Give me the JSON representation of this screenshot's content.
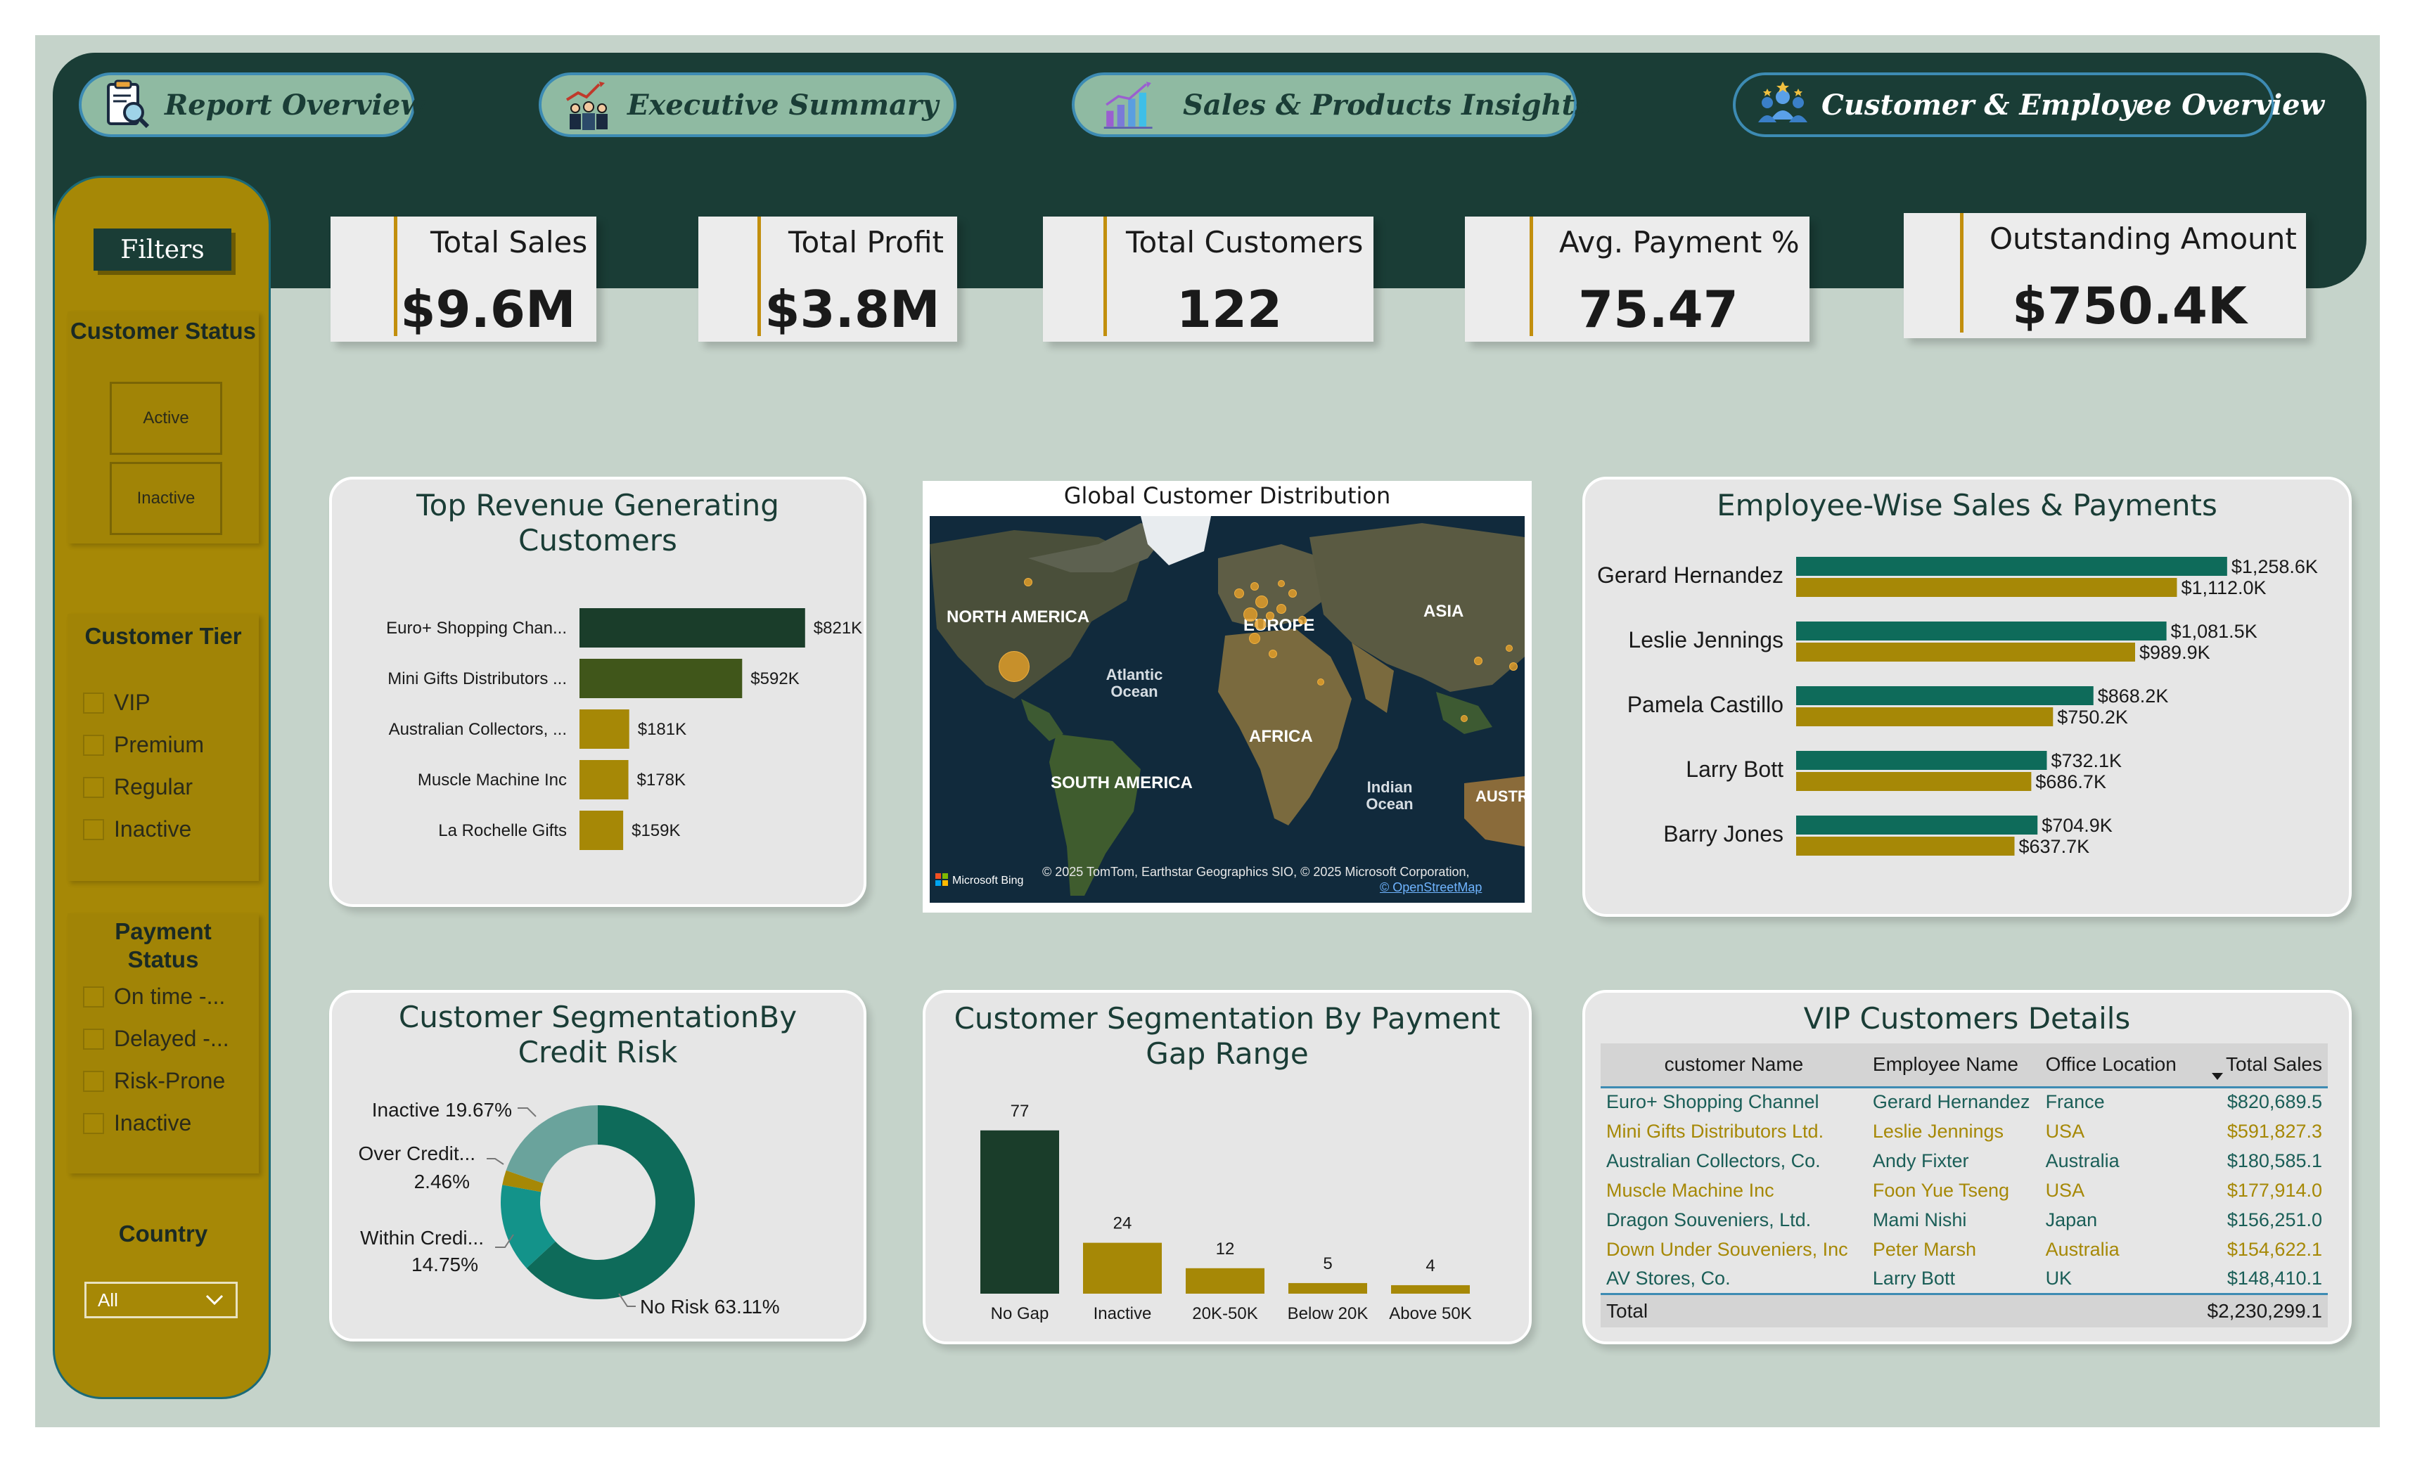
{
  "nav": {
    "tabs": [
      {
        "label": "Report Overview",
        "icon": "report-magnifier-icon"
      },
      {
        "label": "Executive Summary",
        "icon": "executive-team-icon"
      },
      {
        "label": "Sales & Products Insights",
        "icon": "bar-chart-growth-icon"
      },
      {
        "label": "Customer & Employee Overview",
        "icon": "team-group-icon"
      }
    ],
    "active": "Customer & Employee Overview"
  },
  "filters": {
    "title": "Filters",
    "customer_status": {
      "heading": "Customer Status",
      "options": [
        "Active",
        "Inactive"
      ]
    },
    "customer_tier": {
      "heading": "Customer Tier",
      "options": [
        "VIP",
        "Premium",
        "Regular",
        "Inactive"
      ]
    },
    "payment_status": {
      "heading": "Payment Status",
      "options": [
        "On time -...",
        "Delayed -...",
        "Risk-Prone",
        "Inactive"
      ]
    },
    "country": {
      "heading": "Country",
      "selected": "All"
    }
  },
  "kpis": [
    {
      "title": "Total Sales",
      "value": "$9.6M"
    },
    {
      "title": "Total Profit",
      "value": "$3.8M"
    },
    {
      "title": "Total Customers",
      "value": "122"
    },
    {
      "title": "Avg. Payment %",
      "value": "75.47"
    },
    {
      "title": "Outstanding Amount",
      "value": "$750.4K"
    }
  ],
  "top_customers": {
    "title": "Top Revenue Generating Customers",
    "chart_data": {
      "type": "bar",
      "orientation": "horizontal",
      "categories": [
        "Euro+ Shopping Chan...",
        "Mini Gifts Distributors ...",
        "Australian Collectors, ...",
        "Muscle Machine Inc",
        "La Rochelle Gifts"
      ],
      "values": [
        821,
        592,
        181,
        178,
        159
      ],
      "value_labels": [
        "$821K",
        "$592K",
        "$181K",
        "$178K",
        "$159K"
      ],
      "colors": [
        "#1a3d2a",
        "#40561a",
        "#a68806",
        "#a68806",
        "#a68806"
      ],
      "xlim": [
        0,
        900
      ]
    }
  },
  "map": {
    "title": "Global Customer Distribution",
    "labels": [
      "NORTH AMERICA",
      "EUROPE",
      "ASIA",
      "Atlantic Ocean",
      "AFRICA",
      "SOUTH AMERICA",
      "Indian Ocean",
      "AUSTR"
    ],
    "attribution": "© 2025 TomTom, Earthstar Geographics SIO, © 2025 Microsoft Corporation,",
    "osm_link": "© OpenStreetMap",
    "brand": "Microsoft Bing"
  },
  "employee_sales": {
    "title": "Employee-Wise Sales & Payments",
    "chart_data": {
      "type": "bar",
      "orientation": "horizontal",
      "categories": [
        "Gerard Hernandez",
        "Leslie Jennings",
        "Pamela Castillo",
        "Larry Bott",
        "Barry Jones"
      ],
      "series": [
        {
          "values": [
            1258.6,
            1081.5,
            868.2,
            732.1,
            704.9
          ],
          "labels": [
            "$1,258.6K",
            "$1,081.5K",
            "$868.2K",
            "$732.1K",
            "$704.9K"
          ],
          "color": "#0e6b5a"
        },
        {
          "values": [
            1112.0,
            989.9,
            750.2,
            686.7,
            637.7
          ],
          "labels": [
            "$1,112.0K",
            "$989.9K",
            "$750.2K",
            "$686.7K",
            "$637.7K"
          ],
          "color": "#a68806"
        }
      ],
      "xlim": [
        0,
        1300
      ]
    }
  },
  "credit_risk": {
    "title": "Customer SegmentationBy Credit Risk",
    "chart_data": {
      "type": "pie",
      "donut": true,
      "categories": [
        "No Risk",
        "Within Credi...",
        "Over Credit...",
        "Inactive"
      ],
      "values": [
        63.11,
        14.75,
        2.46,
        19.67
      ],
      "labels": [
        "No Risk 63.11%",
        "Within Credi... 14.75%",
        "Over Credit... 2.46%",
        "Inactive 19.67%"
      ],
      "colors": [
        "#0e6b5a",
        "#13938a",
        "#a68806",
        "#6aa39c"
      ]
    }
  },
  "payment_gap": {
    "title": "Customer Segmentation By Payment Gap Range",
    "chart_data": {
      "type": "bar",
      "categories": [
        "No Gap",
        "Inactive",
        "20K-50K",
        "Below 20K",
        "Above 50K"
      ],
      "values": [
        77,
        24,
        12,
        5,
        4
      ],
      "colors": [
        "#1a3d2a",
        "#a68806",
        "#a68806",
        "#a68806",
        "#a68806"
      ],
      "ylim": [
        0,
        80
      ]
    }
  },
  "vip": {
    "title": "VIP Customers Details",
    "columns": [
      "customer Name",
      "Employee Name",
      "Office Location",
      "Total Sales"
    ],
    "rows": [
      [
        "Euro+ Shopping Channel",
        "Gerard Hernandez",
        "France",
        "$820,689.5"
      ],
      [
        "Mini Gifts Distributors Ltd.",
        "Leslie Jennings",
        "USA",
        "$591,827.3"
      ],
      [
        "Australian Collectors, Co.",
        "Andy Fixter",
        "Australia",
        "$180,585.1"
      ],
      [
        "Muscle Machine Inc",
        "Foon Yue Tseng",
        "USA",
        "$177,914.0"
      ],
      [
        "Dragon Souveniers, Ltd.",
        "Mami Nishi",
        "Japan",
        "$156,251.0"
      ],
      [
        "Down Under Souveniers, Inc",
        "Peter Marsh",
        "Australia",
        "$154,622.1"
      ],
      [
        "AV Stores, Co.",
        "Larry Bott",
        "UK",
        "$148,410.1"
      ]
    ],
    "total_label": "Total",
    "total_value": "$2,230,299.1"
  }
}
